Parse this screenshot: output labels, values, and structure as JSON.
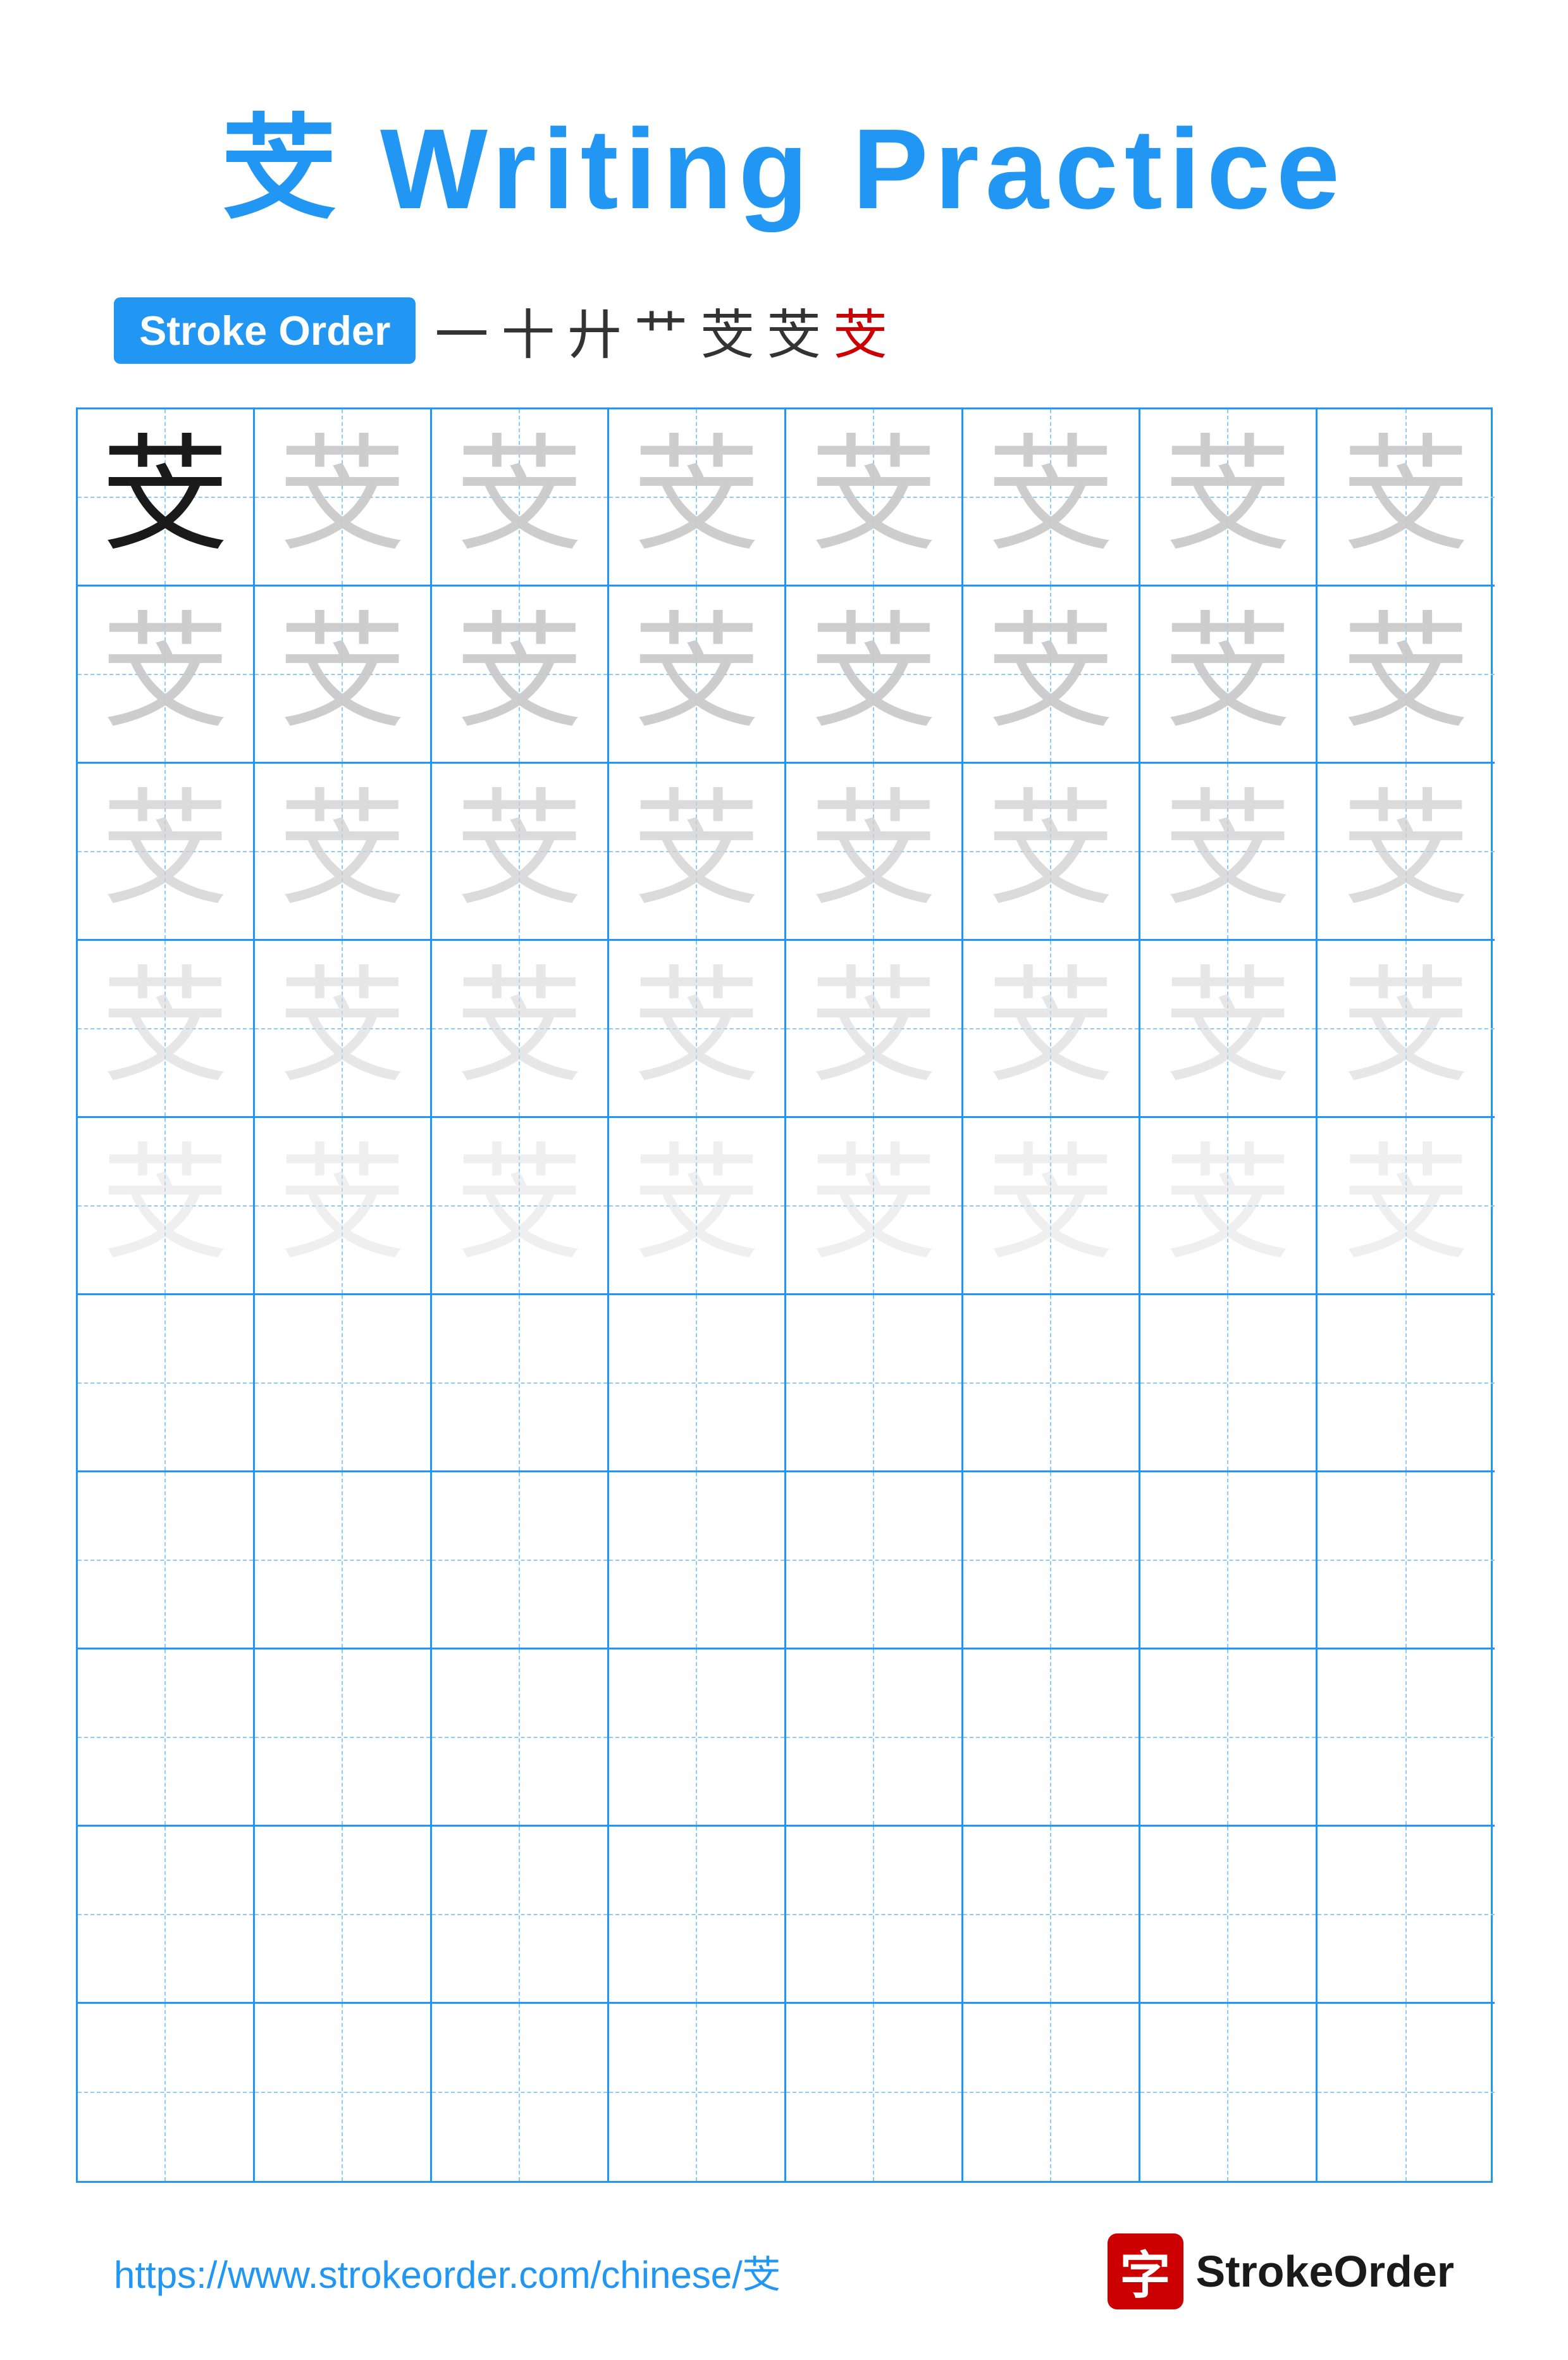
{
  "page": {
    "title": "芠 Writing Practice",
    "title_char": "芠",
    "title_text": "Writing Practice",
    "stroke_order_label": "Stroke Order",
    "stroke_sequence": [
      "一",
      "十",
      "廾",
      "艹",
      "芠",
      "芠",
      "芠"
    ],
    "stroke_sequence_red_index": 6,
    "practice_char": "芠",
    "grid_rows": 10,
    "grid_cols": 8,
    "guide_rows_with_char": 5,
    "footer_url": "https://www.strokeorder.com/chinese/芠",
    "footer_logo_char": "字",
    "footer_logo_name": "StrokeOrder"
  }
}
